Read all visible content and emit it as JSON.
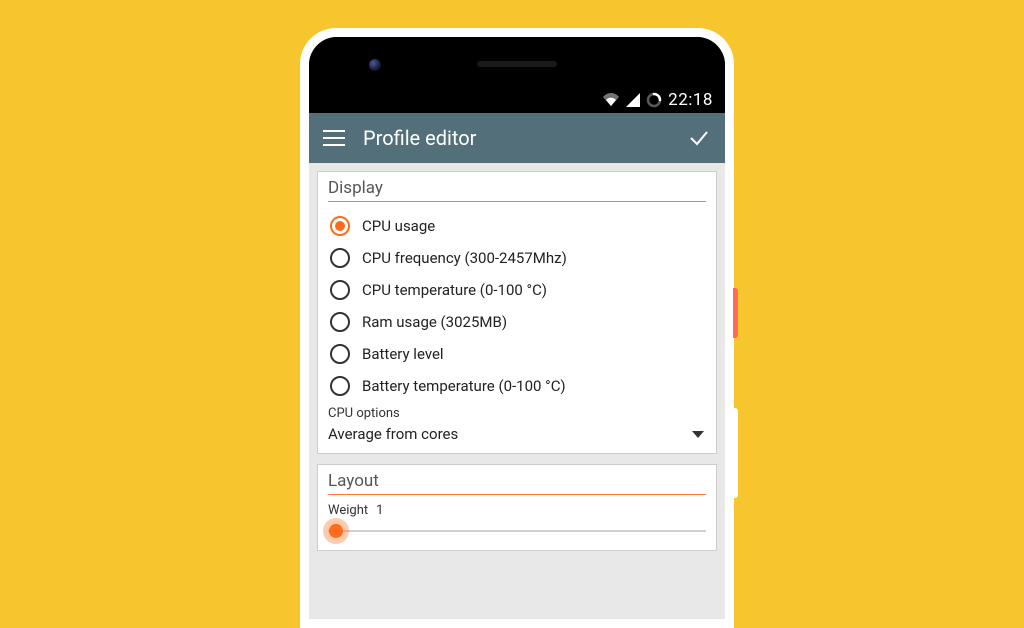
{
  "status": {
    "time": "22:18"
  },
  "appbar": {
    "title": "Profile editor"
  },
  "display": {
    "header": "Display",
    "options": [
      "CPU usage",
      "CPU frequency (300-2457Mhz)",
      "CPU temperature (0-100 °C)",
      "Ram usage (3025MB)",
      "Battery level",
      "Battery temperature (0-100 °C)"
    ],
    "selected_index": 0,
    "cpu_options_label": "CPU options",
    "cpu_options_value": "Average from cores"
  },
  "layout": {
    "header": "Layout",
    "weight_label": "Weight",
    "weight_value": "1"
  }
}
